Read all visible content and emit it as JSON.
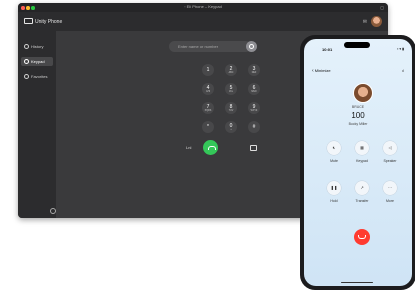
{
  "window": {
    "title": "◦ Eli Phone – Keypad"
  },
  "app": {
    "name": "Unity Phone"
  },
  "sidebar": {
    "items": [
      {
        "label": "History",
        "icon": "clock-icon",
        "active": false
      },
      {
        "label": "Keypad",
        "icon": "keypad-icon",
        "active": true
      },
      {
        "label": "Favorites",
        "icon": "heart-icon",
        "active": false
      }
    ]
  },
  "dialer": {
    "search_placeholder": "Enter name or number",
    "keys": [
      {
        "digit": "1",
        "letters": ""
      },
      {
        "digit": "2",
        "letters": "ABC"
      },
      {
        "digit": "3",
        "letters": "DEF"
      },
      {
        "digit": "4",
        "letters": "GHI"
      },
      {
        "digit": "5",
        "letters": "JKL"
      },
      {
        "digit": "6",
        "letters": "MNO"
      },
      {
        "digit": "7",
        "letters": "PQRS"
      },
      {
        "digit": "8",
        "letters": "TUV"
      },
      {
        "digit": "9",
        "letters": "WXYZ"
      },
      {
        "digit": "*",
        "letters": ""
      },
      {
        "digit": "0",
        "letters": "+"
      },
      {
        "digit": "#",
        "letters": ""
      }
    ],
    "left_action": "Lnl"
  },
  "phone": {
    "time": "10:01",
    "status": "▪ ▾ ▮",
    "back_label": "Minimize",
    "caller_name": "BRUCE",
    "number": "100",
    "company": "Bucky Miller",
    "buttons": [
      {
        "label": "Mute",
        "icon": "mute-icon",
        "glyph": "🔇︎"
      },
      {
        "label": "Keypad",
        "icon": "keypad-icon",
        "glyph": "▦"
      },
      {
        "label": "Speaker",
        "icon": "speaker-icon",
        "glyph": "◁"
      },
      {
        "label": "Hold",
        "icon": "hold-icon",
        "glyph": "❚❚"
      },
      {
        "label": "Transfer",
        "icon": "transfer-icon",
        "glyph": "↗"
      },
      {
        "label": "More",
        "icon": "more-icon",
        "glyph": "⋯"
      }
    ]
  },
  "colors": {
    "call_green": "#34c759",
    "end_red": "#ff3b30"
  }
}
